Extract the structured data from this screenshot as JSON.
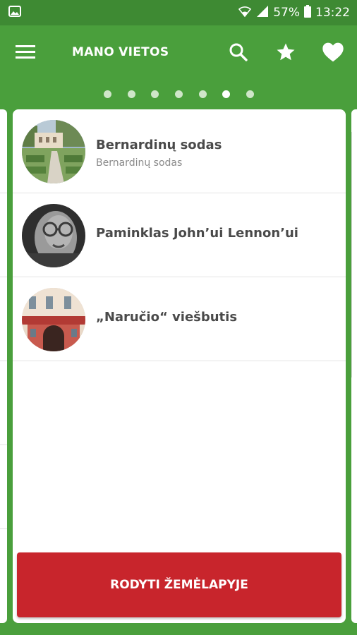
{
  "status_bar": {
    "battery_percent": "57%",
    "time": "13:22",
    "icons": [
      "gallery-notification-icon",
      "wifi-icon",
      "signal-icon",
      "battery-icon"
    ]
  },
  "app_bar": {
    "title": "MANO VIETOS",
    "icons": [
      "menu-icon",
      "search-icon",
      "star-icon",
      "heart-icon"
    ]
  },
  "pager": {
    "count": 7,
    "active_index": 5
  },
  "places": [
    {
      "title": "Bernardinų sodas",
      "subtitle": "Bernardinų sodas",
      "image": "garden-photo"
    },
    {
      "title": "Paminklas John’ui Lennon’ui",
      "subtitle": "",
      "image": "lennon-monument-photo"
    },
    {
      "title": "„Naručio“ viešbutis",
      "subtitle": "",
      "image": "hotel-facade-photo"
    }
  ],
  "map_button": {
    "label": "RODYTI ŽEMĖLAPYJE"
  },
  "colors": {
    "primary_green": "#4a9f3c",
    "status_green": "#3e8a33",
    "button_red": "#c8252c"
  }
}
